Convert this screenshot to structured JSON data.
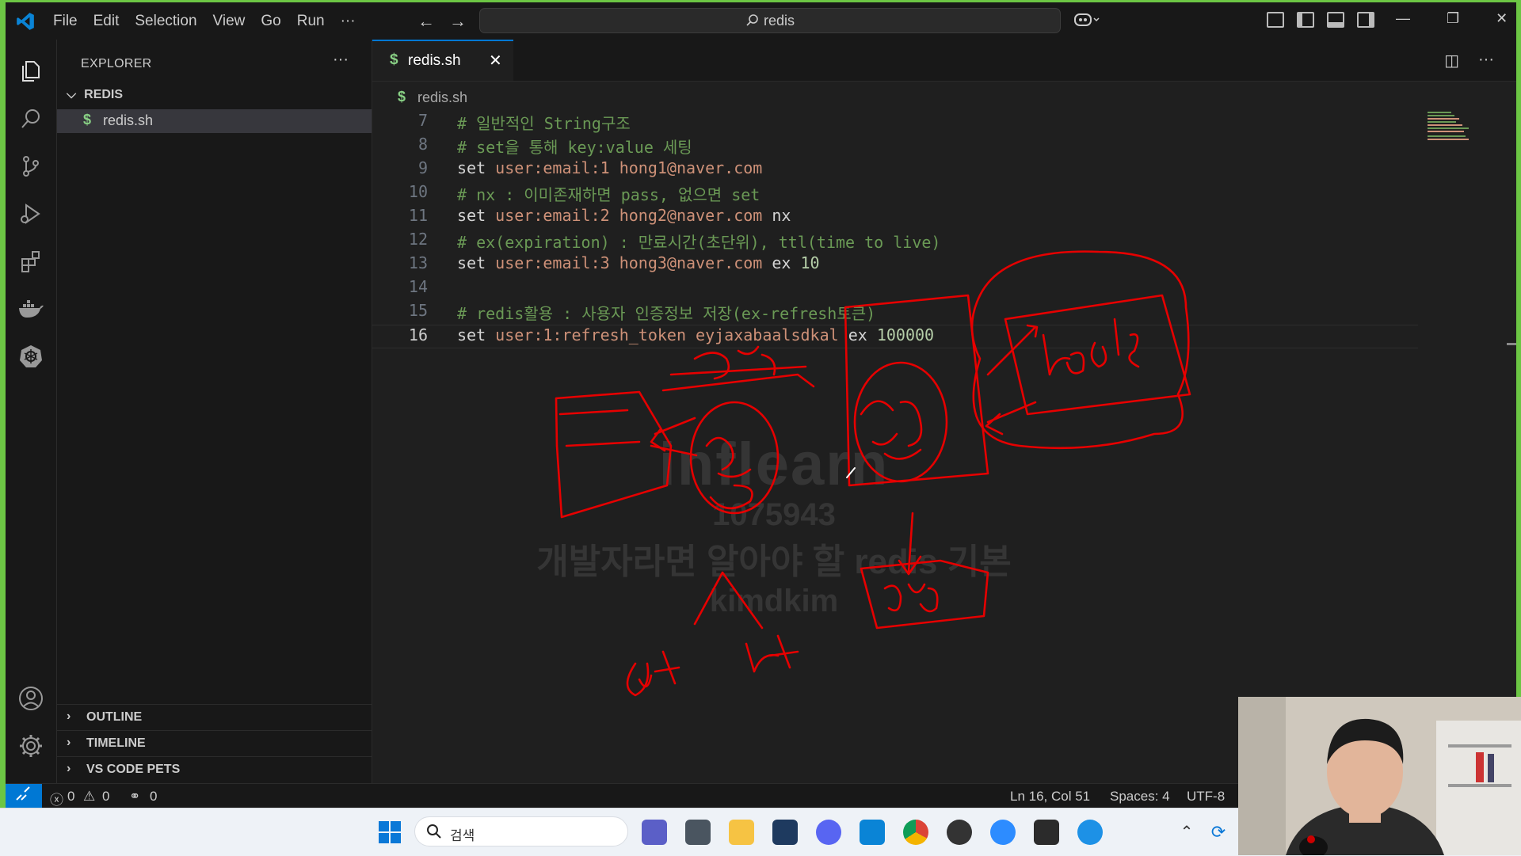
{
  "titlebar": {
    "menu": [
      "File",
      "Edit",
      "Selection",
      "View",
      "Go",
      "Run",
      "···"
    ],
    "search_text": "redis"
  },
  "sidebar": {
    "title": "EXPLORER",
    "more": "···",
    "folder": "REDIS",
    "file": "redis.sh",
    "sections": [
      "OUTLINE",
      "TIMELINE",
      "VS CODE PETS"
    ]
  },
  "editor": {
    "tab_label": "redis.sh",
    "breadcrumb_file": "redis.sh",
    "file_icon": "$",
    "lines": [
      {
        "n": "7",
        "text": "# 일반적인 String구조"
      },
      {
        "n": "8",
        "text": "# set을 통해 key:value 세팅"
      },
      {
        "n": "9",
        "text": "set user:email:1 hong1@naver.com"
      },
      {
        "n": "10",
        "text": "# nx : 이미존재하면 pass, 없으면 set"
      },
      {
        "n": "11",
        "text": "set user:email:2 hong2@naver.com nx"
      },
      {
        "n": "12",
        "text": "# ex(expiration) : 만료시간(초단위), ttl(time to live)"
      },
      {
        "n": "13",
        "text": "set user:email:3 hong3@naver.com ex 10"
      },
      {
        "n": "14",
        "text": ""
      },
      {
        "n": "15",
        "text": "# redis활용 : 사용자 인증정보 저장(ex-refresh토큰)"
      },
      {
        "n": "16",
        "text": "set user:1:refresh_token eyjaxabaalsdkal ex 100000"
      }
    ],
    "current_line": "16"
  },
  "watermark": {
    "brand": "inflearn",
    "id": "1075943",
    "course": "개발자라면 알아야 할 redis 기본",
    "author": "kimdkim"
  },
  "statusbar": {
    "errors": "0",
    "warnings": "0",
    "ports": "0",
    "position": "Ln 16, Col 51",
    "spaces": "Spaces: 4",
    "encoding": "UTF-8"
  },
  "taskbar": {
    "search_placeholder": "검색"
  },
  "colors": {
    "accent": "#0078d4",
    "ink": "#e60000",
    "comment": "#6a9955",
    "string_arg": "#ce9178"
  }
}
